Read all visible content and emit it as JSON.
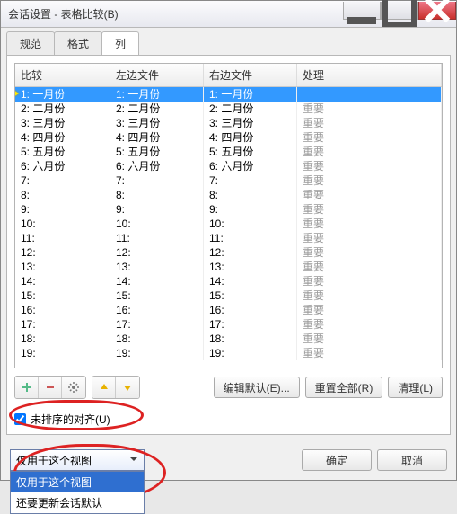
{
  "window": {
    "title": "会话设置 - 表格比较(B)"
  },
  "tabs": [
    {
      "label": "规范",
      "active": false
    },
    {
      "label": "格式",
      "active": false
    },
    {
      "label": "列",
      "active": true
    }
  ],
  "grid": {
    "headers": {
      "c0": "比较",
      "c1": "左边文件",
      "c2": "右边文件",
      "c3": "处理"
    },
    "rows": [
      {
        "n": "1",
        "name": "一月份",
        "proc": "",
        "sel": true
      },
      {
        "n": "2",
        "name": "二月份",
        "proc": "重要",
        "sel": false
      },
      {
        "n": "3",
        "name": "三月份",
        "proc": "重要",
        "sel": false
      },
      {
        "n": "4",
        "name": "四月份",
        "proc": "重要",
        "sel": false
      },
      {
        "n": "5",
        "name": "五月份",
        "proc": "重要",
        "sel": false
      },
      {
        "n": "6",
        "name": "六月份",
        "proc": "重要",
        "sel": false
      },
      {
        "n": "7",
        "name": "",
        "proc": "重要",
        "sel": false
      },
      {
        "n": "8",
        "name": "",
        "proc": "重要",
        "sel": false
      },
      {
        "n": "9",
        "name": "",
        "proc": "重要",
        "sel": false
      },
      {
        "n": "10",
        "name": "",
        "proc": "重要",
        "sel": false
      },
      {
        "n": "11",
        "name": "",
        "proc": "重要",
        "sel": false
      },
      {
        "n": "12",
        "name": "",
        "proc": "重要",
        "sel": false
      },
      {
        "n": "13",
        "name": "",
        "proc": "重要",
        "sel": false
      },
      {
        "n": "14",
        "name": "",
        "proc": "重要",
        "sel": false
      },
      {
        "n": "15",
        "name": "",
        "proc": "重要",
        "sel": false
      },
      {
        "n": "16",
        "name": "",
        "proc": "重要",
        "sel": false
      },
      {
        "n": "17",
        "name": "",
        "proc": "重要",
        "sel": false
      },
      {
        "n": "18",
        "name": "",
        "proc": "重要",
        "sel": false
      },
      {
        "n": "19",
        "name": "",
        "proc": "重要",
        "sel": false
      }
    ]
  },
  "toolbar_icons": {
    "add": "add-icon",
    "remove": "remove-icon",
    "gear": "gear-icon",
    "up": "arrow-up-icon",
    "down": "arrow-down-icon"
  },
  "buttons": {
    "edit_default": "编辑默认(E)...",
    "reset_all": "重置全部(R)",
    "clear": "清理(L)",
    "ok": "确定",
    "cancel": "取消"
  },
  "checkbox": {
    "label": "未排序的对齐(U)",
    "checked": true
  },
  "dropdown": {
    "selected": "仅用于这个视图",
    "options": [
      {
        "label": "仅用于这个视图",
        "selected": true
      },
      {
        "label": "还要更新会话默认",
        "selected": false
      }
    ]
  }
}
